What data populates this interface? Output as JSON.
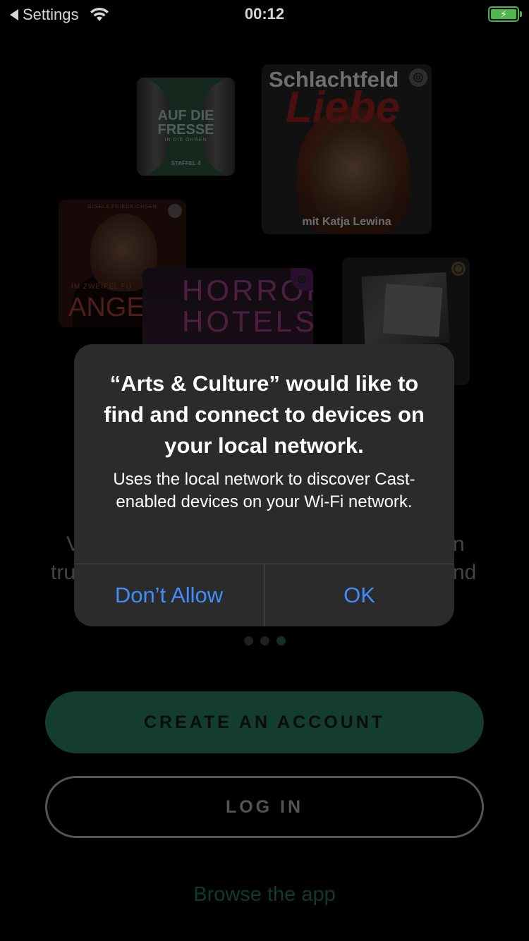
{
  "status_bar": {
    "back_label": "Settings",
    "time": "00:12",
    "battery_state": "charging"
  },
  "artwork": {
    "card1": {
      "line1": "AUF DIE",
      "line2": "FRESSE",
      "line3": "· IN DIE OHREN ·",
      "line4": "STAFFEL 4"
    },
    "card2": {
      "title": "Schlachtfeld",
      "title2": "Liebe",
      "subtitle": "mit Katja Lewina"
    },
    "card3": {
      "top": "GISELA FRIEDRICHSEN",
      "mid": "IM ZWEIFEL FÜ",
      "big": "ANGEKLAG"
    },
    "card4": {
      "title": "HORROR HOTELS"
    }
  },
  "background_text": {
    "fragment1": "V",
    "fragment2": "tru",
    "fragment3": "n",
    "fragment4": "nd"
  },
  "pagination": {
    "count": 3,
    "active_index": 2
  },
  "buttons": {
    "create_account": "CREATE AN ACCOUNT",
    "log_in": "LOG IN",
    "browse": "Browse the app"
  },
  "alert": {
    "title": "“Arts & Culture” would like to find and connect to devices on your local network.",
    "message": "Uses the local network to discover Cast-enabled devices on your Wi-Fi network.",
    "deny_label": "Don’t Allow",
    "ok_label": "OK"
  },
  "colors": {
    "accent_green": "#276f54",
    "alert_button_blue": "#3f8efc",
    "battery_green": "#4cb84c"
  }
}
